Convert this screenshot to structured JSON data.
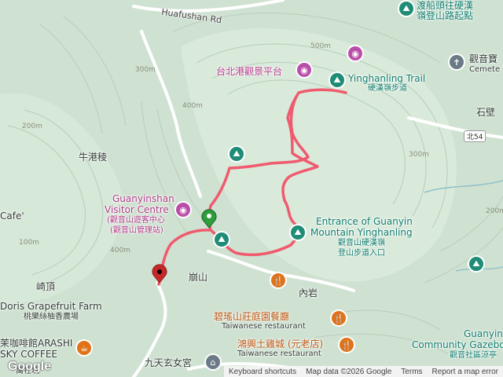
{
  "roads": {
    "huafushan": "Huafushan Rd",
    "north54": "北54"
  },
  "places": {
    "taipei_port_lookout": "台北港觀景平台",
    "yinghanling_trail": "Yinghanling Trail",
    "yinghanling_trail_zh": "硬漢嶺步道",
    "dufutou_top1": "渡船頭往硬漢",
    "dufutou_top2": "嶺登山路起點",
    "guanyin_bao": "觀音寶",
    "cemetery": "Cemete",
    "shibi": "石壁",
    "niugang": "牛港稜",
    "visitor_en1": "Guanyinshan",
    "visitor_en2": "Visitor Centre",
    "visitor_zh": "(觀音山遊客中心",
    "visitor_zh2": "(觀音山管理站)",
    "cafe_left": "Cafe'",
    "qiding": "崎頂",
    "bengshan": "崩山",
    "neiyan": "內岩",
    "entrance_en1": "Entrance of Guanyin",
    "entrance_en2": "Mountain Yinghanling",
    "entrance_zh1": "觀音山硬漢嶺",
    "entrance_zh2": "登山步道入口",
    "biyao_zh": "碧瑤山莊庭園餐廳",
    "biyao_en": "Taiwanese restaurant",
    "hongxing_zh": "鴻興土雞城 (元老店)",
    "hongxing_en": "Taiwanese restaurant",
    "doris_en": "Doris Grapefruit Farm",
    "doris_zh": "桃樂絲柚香農場",
    "arashi1": "茉咖啡館ARASHI",
    "arashi2": "SKY COFFEE",
    "jiutian": "九天玄女宮",
    "gazebo1": "Guanyin",
    "gazebo2": "Community Gazebo",
    "gazebo3": "觀音社區涼亭",
    "bottom_left": "萬牡坑"
  },
  "elevations": [
    "500m",
    "400m",
    "300m",
    "200m",
    "300m",
    "400m",
    "200m",
    "100m"
  ],
  "footer": {
    "logo": "Google",
    "shortcuts": "Keyboard shortcuts",
    "mapdata": "Map data ©2026 Google",
    "terms": "Terms",
    "report": "Report a map error"
  },
  "colors": {
    "route": "#f05a6e",
    "terrain": "#cfe2d2",
    "road": "#ffffff",
    "start_pin": "#2f9e3a",
    "end_pin": "#c62828"
  }
}
